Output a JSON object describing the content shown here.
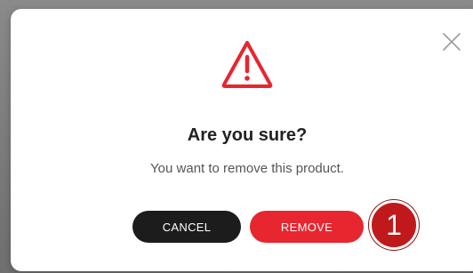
{
  "dialog": {
    "title": "Are you sure?",
    "message": "You want to remove this product.",
    "cancel_label": "CANCEL",
    "remove_label": "REMOVE",
    "close_icon": "close-icon",
    "warning_icon": "warning-triangle-icon"
  },
  "annotation": {
    "step_number": "1"
  },
  "colors": {
    "accent": "#e7262f",
    "cancel_button": "#1c1c1c",
    "warning_icon": "#e7262f",
    "step_badge": "#c0191b"
  }
}
